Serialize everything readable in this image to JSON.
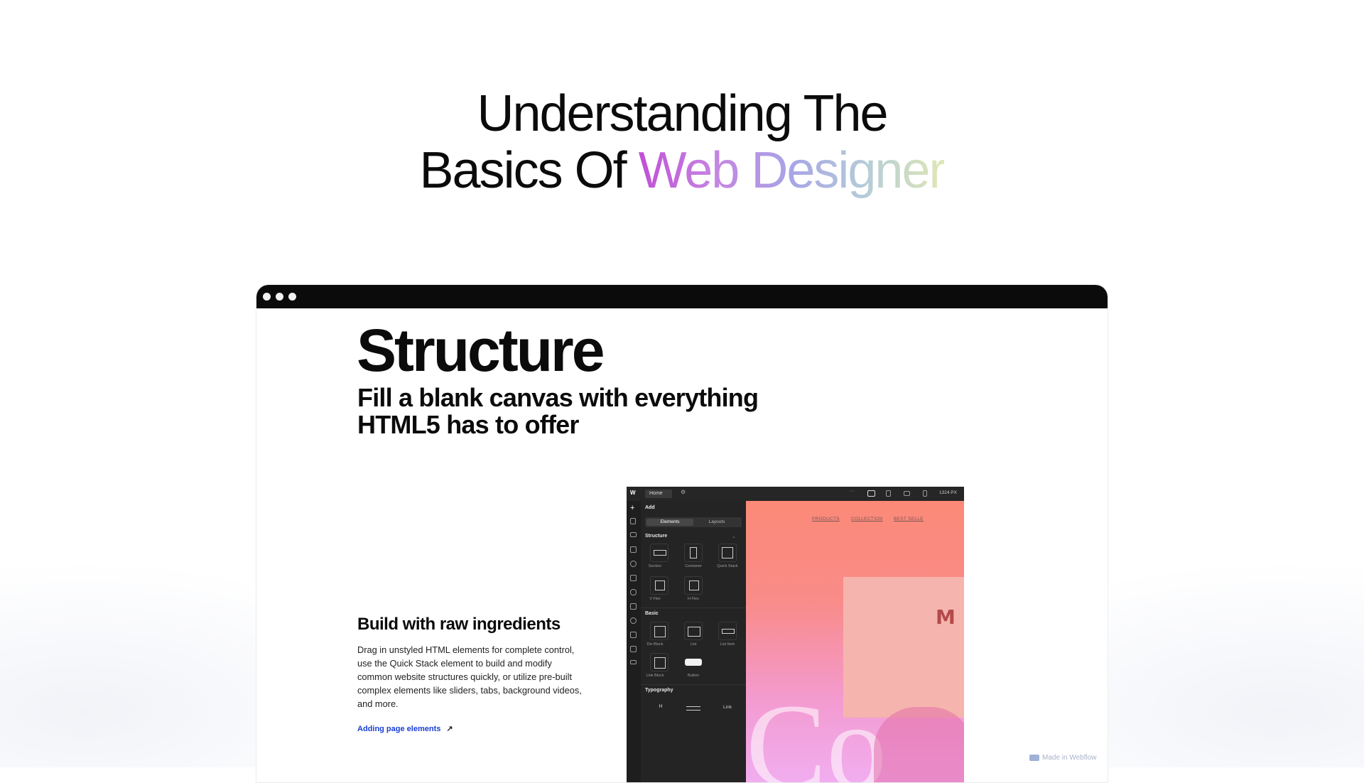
{
  "hero": {
    "line1": "Understanding The",
    "line2_plain": "Basics Of ",
    "line2_gradient": "Web Designer"
  },
  "browser": {
    "structure_title": "Structure",
    "structure_sub": "Fill a blank canvas with everything HTML5 has to offer",
    "build_title": "Build with raw ingredients",
    "build_desc": "Drag in unstyled HTML elements for complete control, use the Quick Stack element to build and modify common website structures quickly, or utilize pre-built complex elements like sliders, tabs, background videos, and more.",
    "link_text": "Adding page elements",
    "link_arrow": "↗",
    "made_in": "Made in Webflow"
  },
  "designer": {
    "logo": "W",
    "home_label": "Home",
    "more": "···",
    "size_label": "1324 PX",
    "panel_title": "Add",
    "tabs": [
      "Elements",
      "Layouts"
    ],
    "structure_head": "Structure",
    "structure_items": [
      "Section",
      "Container",
      "Quick Stack",
      "V Flex",
      "H Flex"
    ],
    "basic_head": "Basic",
    "basic_items": [
      "Div Block",
      "List",
      "List Item",
      "Link Block",
      "Button"
    ],
    "typography_head": "Typography",
    "typography_items": [
      "H",
      "",
      "Link"
    ],
    "canvas_nav": [
      "PRODUCTS",
      "COLLECTION",
      "BEST SELLE"
    ],
    "canvas_letter": "M",
    "canvas_big_text": "Co"
  },
  "colors": {
    "gradient_start": "#c050d6",
    "gradient_mid": "#a7a5e6",
    "gradient_end": "#dfe7b4",
    "topbar": "#0b0b0b",
    "link": "#1a3fd6"
  }
}
